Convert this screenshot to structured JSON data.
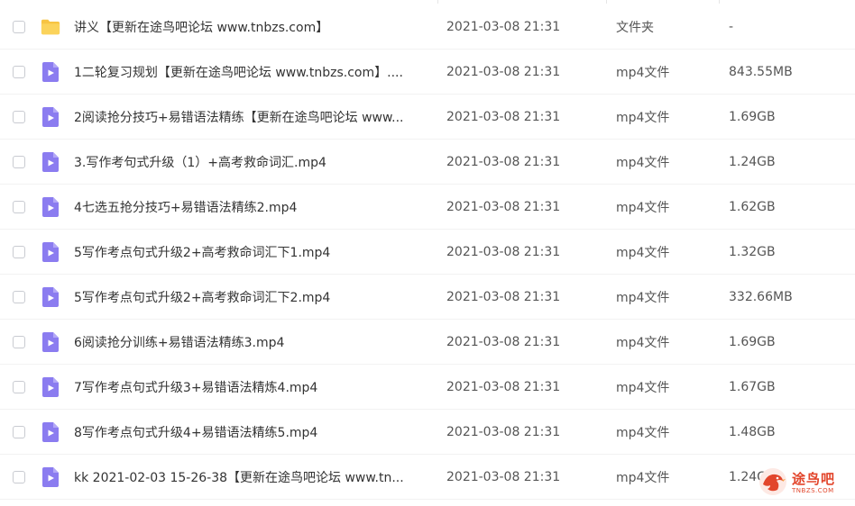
{
  "files": [
    {
      "name": "讲义【更新在途鸟吧论坛 www.tnbzs.com】",
      "time": "2021-03-08 21:31",
      "type": "文件夹",
      "size": "-",
      "icon": "folder-icon"
    },
    {
      "name": "1二轮复习规划【更新在途鸟吧论坛 www.tnbzs.com】....",
      "time": "2021-03-08 21:31",
      "type": "mp4文件",
      "size": "843.55MB",
      "icon": "video-file-icon"
    },
    {
      "name": "2阅读抢分技巧+易错语法精练【更新在途鸟吧论坛 www...",
      "time": "2021-03-08 21:31",
      "type": "mp4文件",
      "size": "1.69GB",
      "icon": "video-file-icon"
    },
    {
      "name": "3.写作考句式升级（1）+高考救命词汇.mp4",
      "time": "2021-03-08 21:31",
      "type": "mp4文件",
      "size": "1.24GB",
      "icon": "video-file-icon"
    },
    {
      "name": "4七选五抢分技巧+易错语法精练2.mp4",
      "time": "2021-03-08 21:31",
      "type": "mp4文件",
      "size": "1.62GB",
      "icon": "video-file-icon"
    },
    {
      "name": "5写作考点句式升级2+高考救命词汇下1.mp4",
      "time": "2021-03-08 21:31",
      "type": "mp4文件",
      "size": "1.32GB",
      "icon": "video-file-icon"
    },
    {
      "name": "5写作考点句式升级2+高考救命词汇下2.mp4",
      "time": "2021-03-08 21:31",
      "type": "mp4文件",
      "size": "332.66MB",
      "icon": "video-file-icon"
    },
    {
      "name": "6阅读抢分训练+易错语法精练3.mp4",
      "time": "2021-03-08 21:31",
      "type": "mp4文件",
      "size": "1.69GB",
      "icon": "video-file-icon"
    },
    {
      "name": "7写作考点句式升级3+易错语法精炼4.mp4",
      "time": "2021-03-08 21:31",
      "type": "mp4文件",
      "size": "1.67GB",
      "icon": "video-file-icon"
    },
    {
      "name": "8写作考点句式升级4+易错语法精练5.mp4",
      "time": "2021-03-08 21:31",
      "type": "mp4文件",
      "size": "1.48GB",
      "icon": "video-file-icon"
    },
    {
      "name": "kk 2021-02-03 15-26-38【更新在途鸟吧论坛 www.tn...",
      "time": "2021-03-08 21:31",
      "type": "mp4文件",
      "size": "1.24G",
      "icon": "video-file-icon"
    }
  ],
  "watermark": {
    "text": "途鸟吧",
    "subtext": "TNBZS.COM"
  },
  "colors": {
    "folder": "#f7c443",
    "video_icon": "#8b7cf0",
    "watermark": "#e2452b"
  }
}
